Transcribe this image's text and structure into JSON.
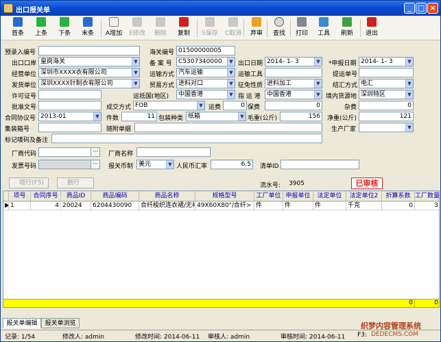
{
  "title": "出口报关单",
  "toolbar": {
    "first": "首条",
    "prev": "上条",
    "next": "下条",
    "last": "末条",
    "add": "A增加",
    "modify": "E修改",
    "delete": "删除",
    "copy": "复制",
    "save": "S保存",
    "cancel": "C取消",
    "review": "弃审",
    "find": "查找",
    "print": "打印",
    "tools": "工具",
    "refresh": "刷新",
    "exit": "退出"
  },
  "form": {
    "pre_entry_no_label": "预录入编号",
    "pre_entry_no": "",
    "customs_no_label": "海关编号",
    "customs_no": "01500000005",
    "exit_port_label": "出口口岸",
    "exit_port": "皇岗海关",
    "record_no_label": "备 案 号",
    "record_no": "C5307340000",
    "exit_date_label": "出口日期",
    "exit_date": "2014- 1- 3",
    "declare_date_label": "*申报日期",
    "declare_date": "2014- 1- 3",
    "operator_label": "经营单位",
    "operator": "深圳市XXXX衣有限公司",
    "transport_label": "运输方式",
    "transport": "汽车运输",
    "tool_label": "运输工具",
    "tool": "",
    "bill_label": "提运单号",
    "bill": "",
    "shipper_label": "发货单位",
    "shipper": "深圳XXXX针制衣有限公司",
    "trade_label": "贸易方式",
    "trade": "进料对口",
    "levy_label": "征免性质",
    "levy": "进料加工",
    "settle_label": "结汇方式",
    "settle": "电汇",
    "license_label": "许可证号",
    "license": "",
    "dest_country_label": "运抵国(地区)",
    "dest_country": "中国香港",
    "port_label": "指 运 港",
    "port": "中国香港",
    "source_label": "境内货源地",
    "source": "深圳特区",
    "approval_label": "批准文号",
    "approval": "",
    "deal_label": "成交方式",
    "deal": "FOB",
    "freight_label": "运费",
    "freight": "0",
    "insurance_label": "保费",
    "insurance": "0",
    "misc_label": "杂费",
    "misc": "0",
    "contract_label": "合同协议号",
    "contract": "2013-01",
    "pieces_label": "件数",
    "pieces": "11",
    "pack_label": "包装种类",
    "pack": "纸箱",
    "gross_label": "毛重(公斤)",
    "gross": "156",
    "net_label": "净重(公斤)",
    "net": "121",
    "container_label": "集装箱号",
    "container": "",
    "docs_label": "随附单据",
    "docs": "",
    "manufacturer_label": "生产厂家",
    "manufacturer": "",
    "marks_label": "标记唛码及备注",
    "marks": "",
    "vendor_code_label": "厂商代码",
    "vendor_code": "",
    "vendor_name_label": "厂商名称",
    "vendor_name": "",
    "invoice_label": "发票号码",
    "invoice": "",
    "currency_label": "报关币制",
    "currency": "美元",
    "rate_label": "人民币汇率",
    "rate": "6.5",
    "list_label": "清单ID",
    "list": ""
  },
  "subbar": {
    "add_row": "增行(F5)",
    "del_row": "删行",
    "serial_label": "流水号:",
    "serial": "3905",
    "approved": "已审核"
  },
  "grid": {
    "headers": [
      "项号",
      "合同序号",
      "商品ID",
      "商品编码",
      "商品名称",
      "规格型号",
      "工厂单位",
      "申报单位",
      "法定单位",
      "法定单位2",
      "折算系数",
      "工厂数量"
    ],
    "rows": [
      [
        "1",
        "4",
        "20024",
        "6204430090",
        "合纤梭织连衣裙/无袖",
        "49X60X80\"/合纤>",
        "件",
        "件",
        "件",
        "千克",
        "0",
        "3"
      ]
    ],
    "totals": [
      "0",
      "0"
    ]
  },
  "tabs": [
    "报关单编辑",
    "报关单浏览"
  ],
  "status": {
    "record": "记录: 1/54",
    "modifier": "修改人: admin",
    "modify_time": "修改时间: 2014-06-11",
    "reviewer": "审核人: admin",
    "review_time": "审核时间: 2014-06-11",
    "extra": "F3:"
  },
  "watermark": "织梦内容管理系统",
  "watermark_url": "DEDECMS.COM",
  "colors": {
    "title_blue": "#0a4ad0",
    "approved_red": "#e02020",
    "totals_yellow": "#ffff00"
  }
}
